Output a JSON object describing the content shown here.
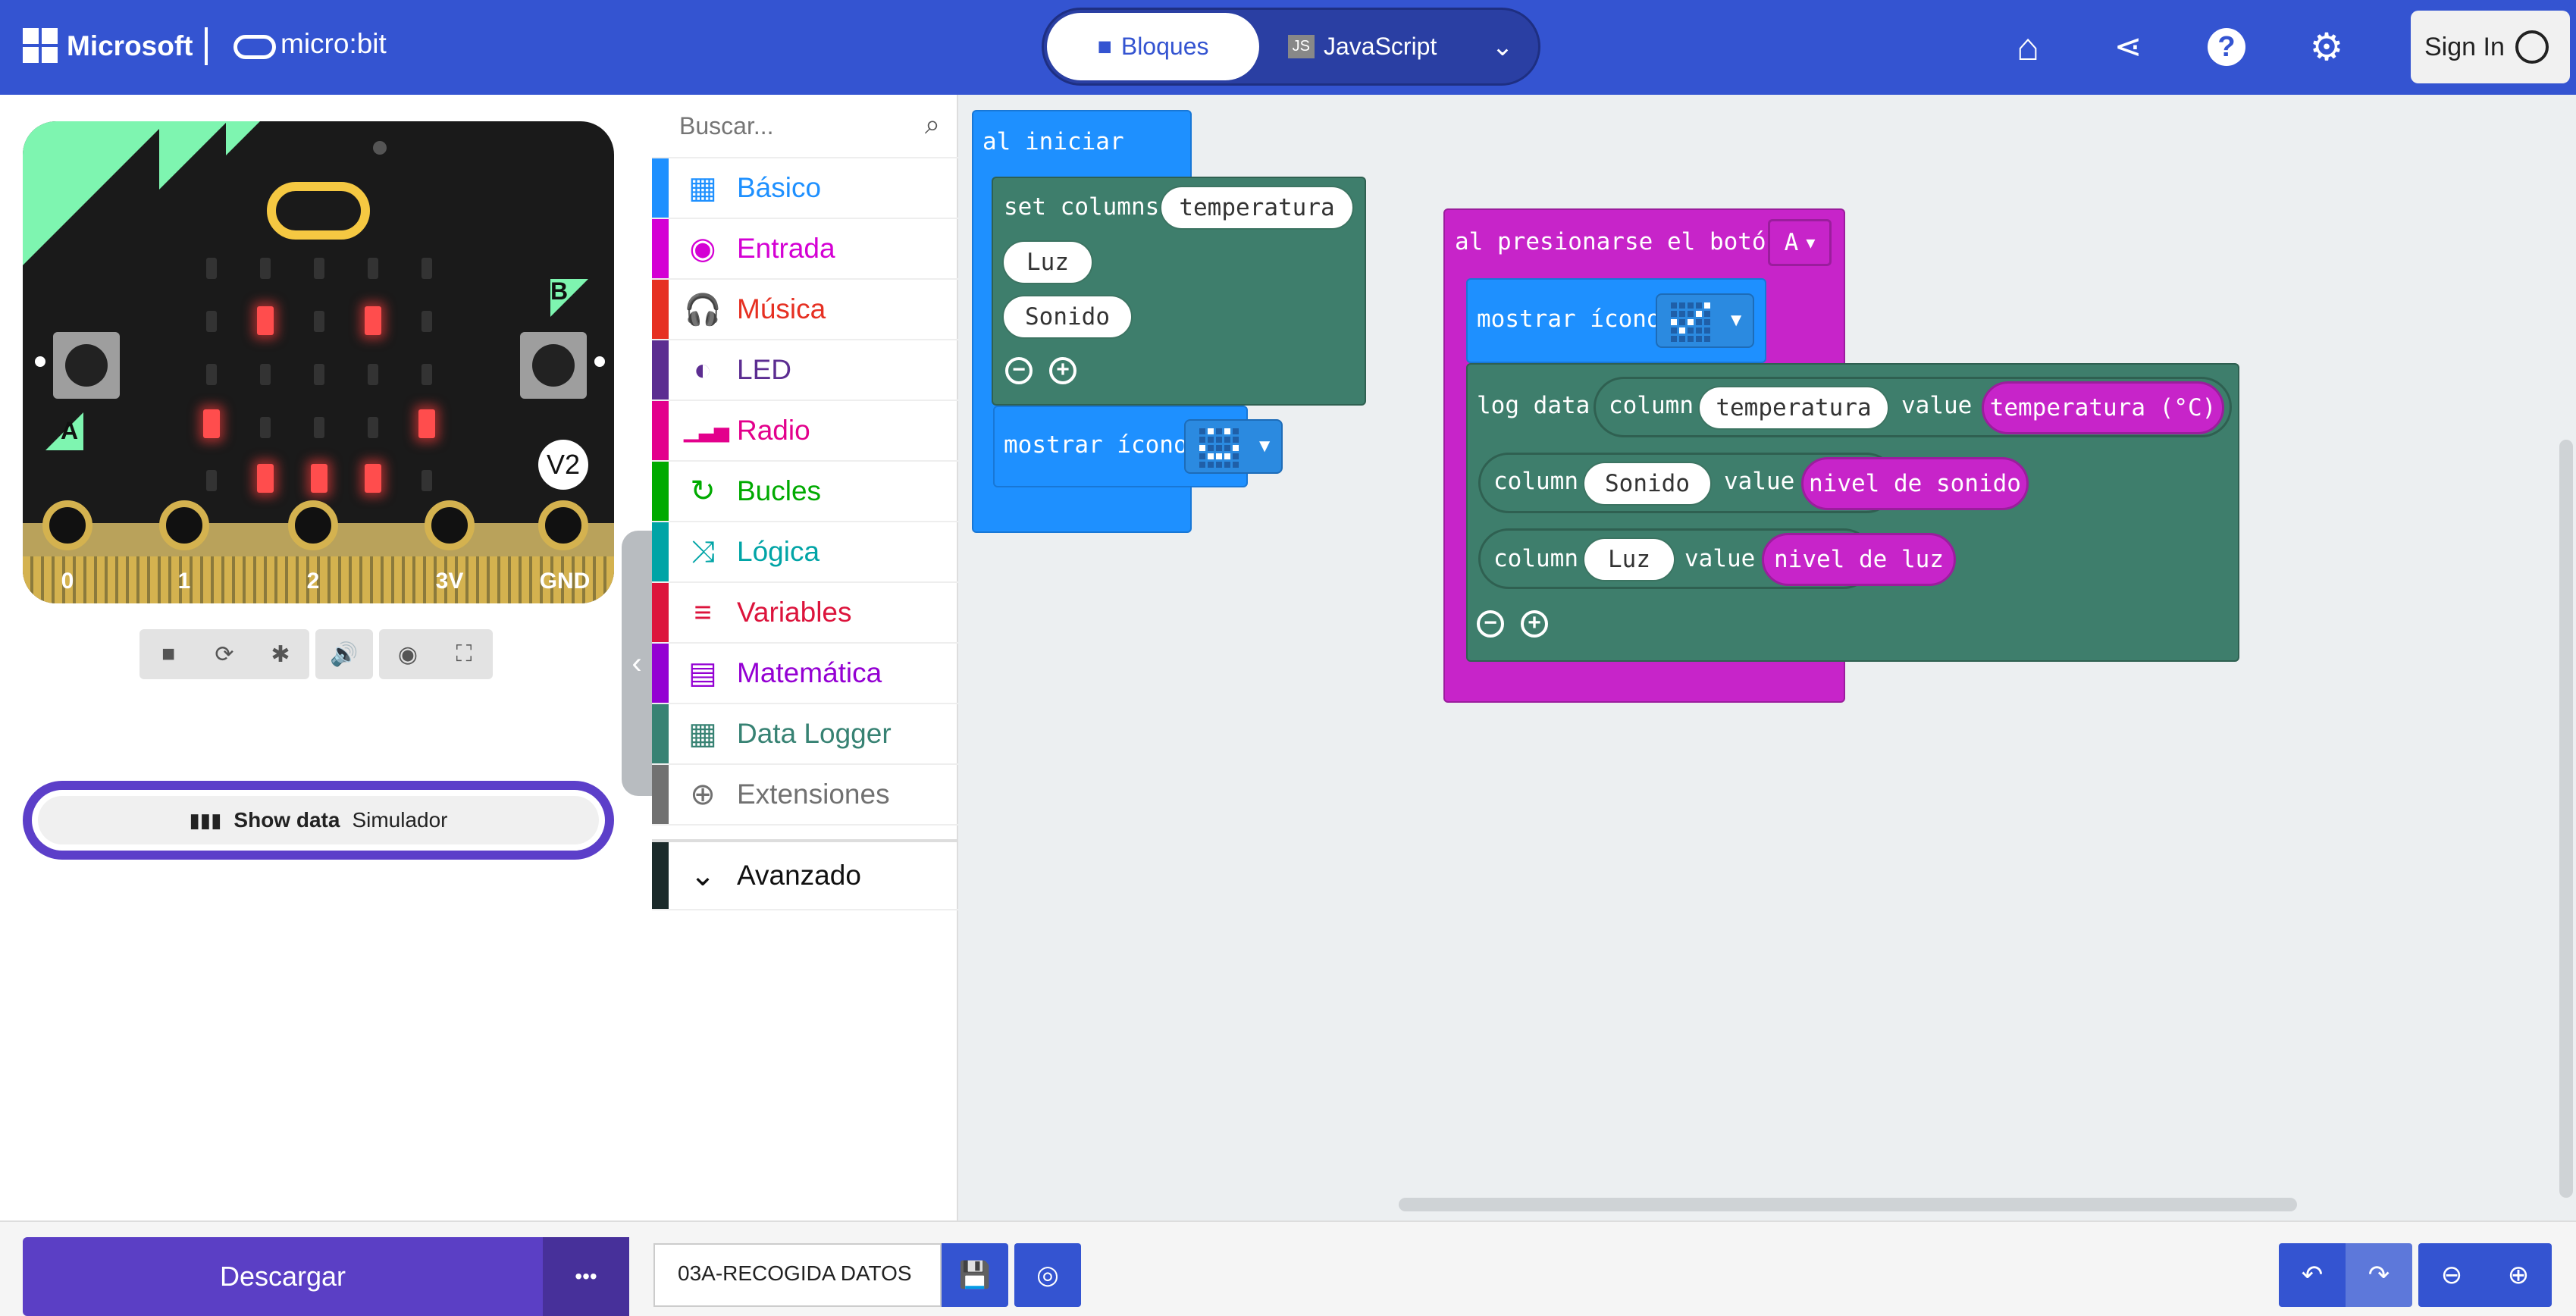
{
  "header": {
    "brand": "Microsoft",
    "product": "micro:bit",
    "mode_blocks": "Bloques",
    "mode_js": "JavaScript",
    "signin": "Sign In",
    "icons": [
      "home-icon",
      "share-icon",
      "help-icon",
      "settings-icon"
    ],
    "color": "#3454d1"
  },
  "simulator": {
    "pins": [
      "0",
      "1",
      "2",
      "3V",
      "GND"
    ],
    "button_a": "A",
    "button_b": "B",
    "version": "V2",
    "controls": [
      "stop-icon",
      "restart-icon",
      "debug-icon",
      "sound-icon",
      "screenshot-icon",
      "fullscreen-icon"
    ],
    "show_data": "Show data",
    "show_data_sub": "Simulador"
  },
  "toolbox": {
    "search_placeholder": "Buscar...",
    "categories": [
      {
        "label": "Básico",
        "color": "#1e90ff",
        "icon": "grid-icon"
      },
      {
        "label": "Entrada",
        "color": "#d400d4",
        "icon": "target-icon"
      },
      {
        "label": "Música",
        "color": "#e63022",
        "icon": "headphones-icon"
      },
      {
        "label": "LED",
        "color": "#5c2d91",
        "icon": "toggle-icon"
      },
      {
        "label": "Radio",
        "color": "#e3008c",
        "icon": "signal-icon"
      },
      {
        "label": "Bucles",
        "color": "#00aa00",
        "icon": "refresh-icon"
      },
      {
        "label": "Lógica",
        "color": "#00a4a6",
        "icon": "shuffle-icon"
      },
      {
        "label": "Variables",
        "color": "#dc143c",
        "icon": "lines-icon"
      },
      {
        "label": "Matemática",
        "color": "#9400d3",
        "icon": "calculator-icon"
      },
      {
        "label": "Data Logger",
        "color": "#378273",
        "icon": "table-icon"
      },
      {
        "label": "Extensiones",
        "color": "#717171",
        "icon": "plus-icon"
      }
    ],
    "advanced": "Avanzado"
  },
  "workspace": {
    "on_start": {
      "hat": "al iniciar",
      "set_columns": "set columns",
      "col1": "temperatura",
      "col2": "Luz",
      "col3": "Sonido",
      "show_icon": "mostrar ícono"
    },
    "on_button": {
      "hat": "al presionarse el botón",
      "button": "A",
      "show_icon": "mostrar ícono",
      "log_data": "log data",
      "column_word": "column",
      "value_word": "value",
      "rows": [
        {
          "column": "temperatura",
          "value": "temperatura (°C)"
        },
        {
          "column": "Sonido",
          "value": "nivel de sonido"
        },
        {
          "column": "Luz",
          "value": "nivel de luz"
        }
      ]
    }
  },
  "footer": {
    "download": "Descargar",
    "more": "•••",
    "project_name": "03A-RECOGIDA DATOS"
  }
}
